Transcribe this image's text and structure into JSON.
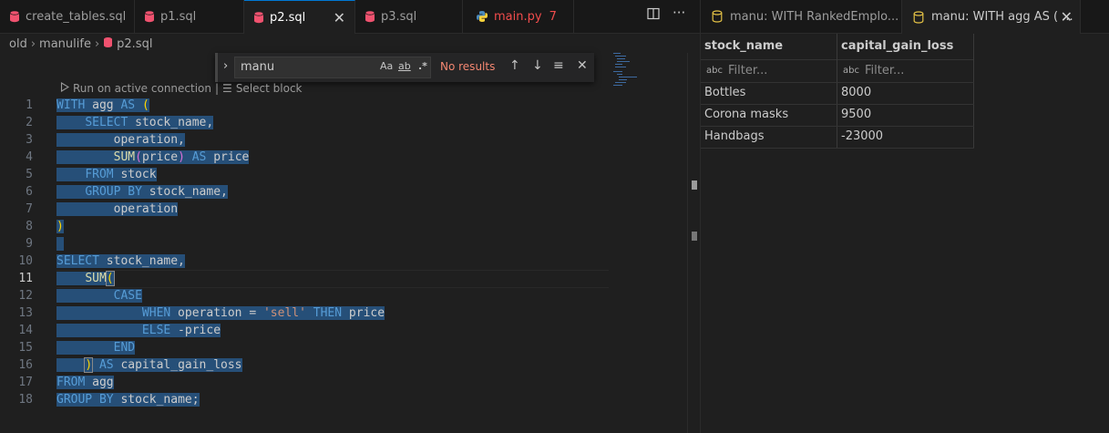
{
  "editor_tabs": [
    {
      "label": "create_tables.sql",
      "icon": "database-icon"
    },
    {
      "label": "p1.sql",
      "icon": "database-icon"
    },
    {
      "label": "p2.sql",
      "icon": "database-icon",
      "active": true
    },
    {
      "label": "p3.sql",
      "icon": "database-icon"
    },
    {
      "label": "main.py",
      "icon": "python-icon",
      "problems": "7"
    }
  ],
  "breadcrumb": [
    "old",
    "manulife",
    "p2.sql"
  ],
  "find": {
    "query": "manu",
    "match_case": "Aa",
    "whole_word": "ab",
    "regex": ".*",
    "status": "No results"
  },
  "codelens": {
    "run": "Run on active connection",
    "sep": "|",
    "select": "Select block"
  },
  "line_numbers": [
    "1",
    "2",
    "3",
    "4",
    "5",
    "6",
    "7",
    "8",
    "9",
    "10",
    "11",
    "12",
    "13",
    "14",
    "15",
    "16",
    "17",
    "18"
  ],
  "code_lines": [
    "WITH agg AS (",
    "    SELECT stock_name,",
    "        operation,",
    "        SUM(price) AS price",
    "    FROM stock",
    "    GROUP BY stock_name,",
    "        operation",
    ")",
    "",
    "SELECT stock_name,",
    "    SUM(",
    "        CASE",
    "            WHEN operation = 'sell' THEN price",
    "            ELSE -price",
    "        END",
    "    ) AS capital_gain_loss",
    "FROM agg",
    "GROUP BY stock_name;"
  ],
  "result_tabs": [
    {
      "label": "manu: WITH RankedEmplo..."
    },
    {
      "label": "manu: WITH agg AS ( ...",
      "active": true
    }
  ],
  "results": {
    "columns": [
      "stock_name",
      "capital_gain_loss"
    ],
    "filter_placeholder": "Filter...",
    "rows": [
      [
        "Bottles",
        "8000"
      ],
      [
        "Corona masks",
        "9500"
      ],
      [
        "Handbags",
        "-23000"
      ]
    ]
  }
}
